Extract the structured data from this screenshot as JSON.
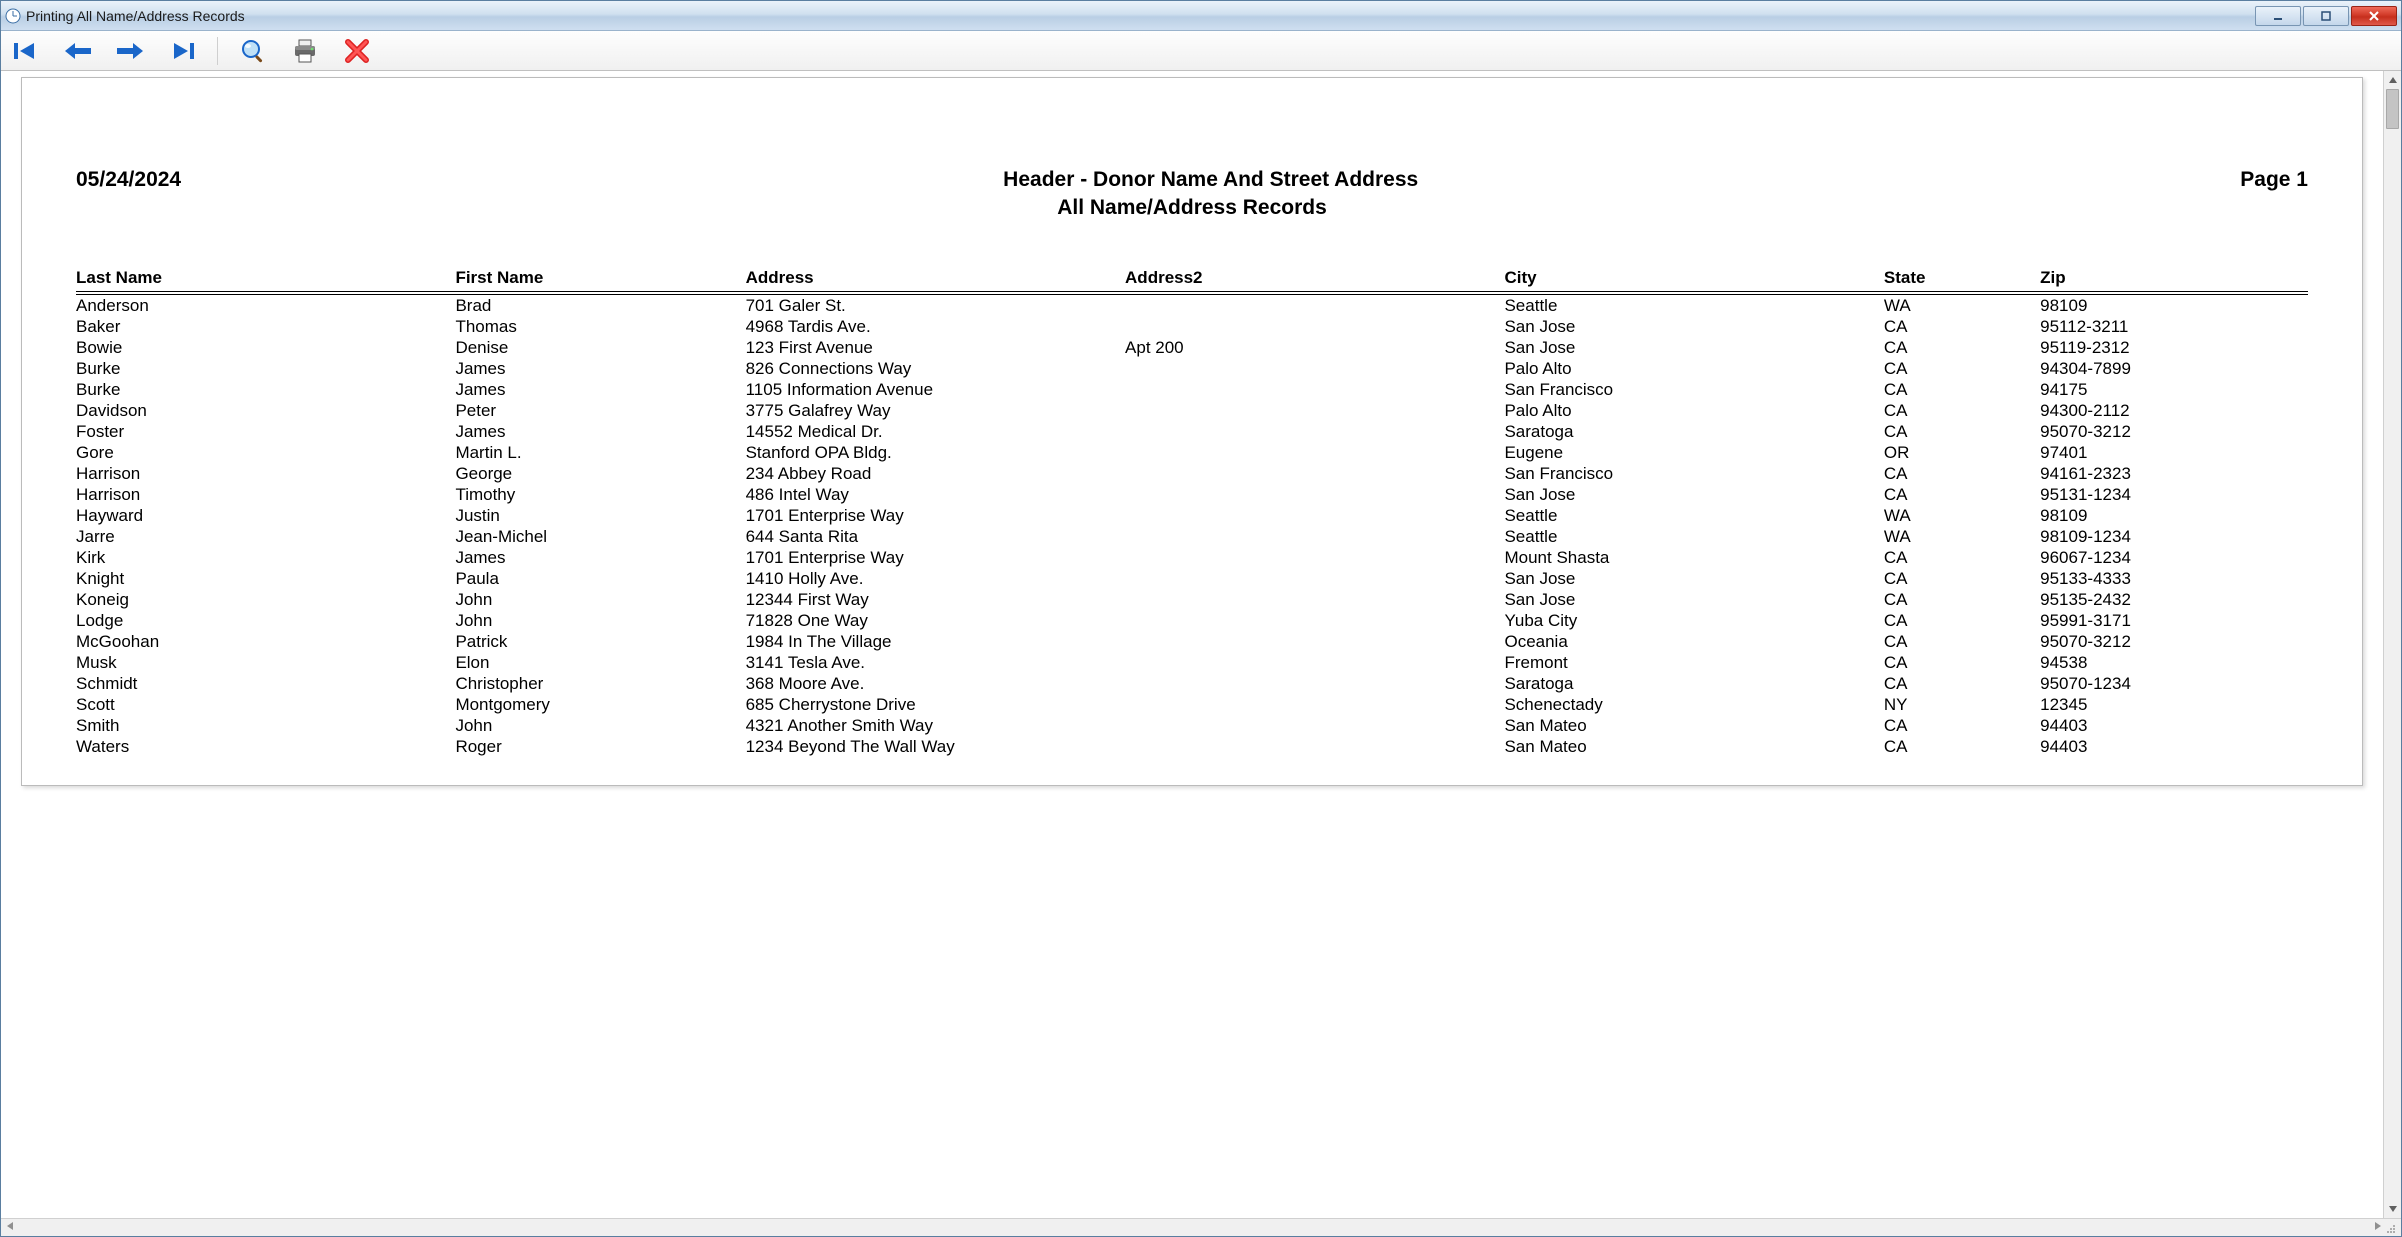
{
  "window": {
    "title": "Printing All Name/Address Records"
  },
  "report": {
    "date": "05/24/2024",
    "title": "Header - Donor Name And Street Address",
    "subtitle": "All Name/Address Records",
    "page_label": "Page 1"
  },
  "columns": {
    "last": "Last Name",
    "first": "First Name",
    "addr": "Address",
    "addr2": "Address2",
    "city": "City",
    "state": "State",
    "zip": "Zip"
  },
  "rows": [
    {
      "last": "Anderson",
      "first": "Brad",
      "addr": "701 Galer St.",
      "addr2": "",
      "city": "Seattle",
      "state": "WA",
      "zip": "98109"
    },
    {
      "last": "Baker",
      "first": "Thomas",
      "addr": "4968 Tardis Ave.",
      "addr2": "",
      "city": "San Jose",
      "state": "CA",
      "zip": "95112-3211"
    },
    {
      "last": "Bowie",
      "first": "Denise",
      "addr": "123 First Avenue",
      "addr2": "Apt 200",
      "city": "San Jose",
      "state": "CA",
      "zip": "95119-2312"
    },
    {
      "last": "Burke",
      "first": "James",
      "addr": "826 Connections Way",
      "addr2": "",
      "city": "Palo Alto",
      "state": "CA",
      "zip": "94304-7899"
    },
    {
      "last": "Burke",
      "first": "James",
      "addr": "1105 Information Avenue",
      "addr2": "",
      "city": "San Francisco",
      "state": "CA",
      "zip": "94175"
    },
    {
      "last": "Davidson",
      "first": "Peter",
      "addr": "3775 Galafrey Way",
      "addr2": "",
      "city": "Palo Alto",
      "state": "CA",
      "zip": "94300-2112"
    },
    {
      "last": "Foster",
      "first": "James",
      "addr": "14552 Medical Dr.",
      "addr2": "",
      "city": "Saratoga",
      "state": "CA",
      "zip": "95070-3212"
    },
    {
      "last": "Gore",
      "first": "Martin L.",
      "addr": "Stanford OPA Bldg.",
      "addr2": "",
      "city": "Eugene",
      "state": "OR",
      "zip": "97401"
    },
    {
      "last": "Harrison",
      "first": "George",
      "addr": "234 Abbey Road",
      "addr2": "",
      "city": "San Francisco",
      "state": "CA",
      "zip": "94161-2323"
    },
    {
      "last": "Harrison",
      "first": "Timothy",
      "addr": "486 Intel Way",
      "addr2": "",
      "city": "San Jose",
      "state": "CA",
      "zip": "95131-1234"
    },
    {
      "last": "Hayward",
      "first": "Justin",
      "addr": "1701 Enterprise Way",
      "addr2": "",
      "city": "Seattle",
      "state": "WA",
      "zip": "98109"
    },
    {
      "last": "Jarre",
      "first": "Jean-Michel",
      "addr": "644 Santa Rita",
      "addr2": "",
      "city": "Seattle",
      "state": "WA",
      "zip": "98109-1234"
    },
    {
      "last": "Kirk",
      "first": "James",
      "addr": "1701 Enterprise Way",
      "addr2": "",
      "city": "Mount Shasta",
      "state": "CA",
      "zip": "96067-1234"
    },
    {
      "last": "Knight",
      "first": "Paula",
      "addr": "1410 Holly Ave.",
      "addr2": "",
      "city": "San Jose",
      "state": "CA",
      "zip": "95133-4333"
    },
    {
      "last": "Koneig",
      "first": "John",
      "addr": "12344 First Way",
      "addr2": "",
      "city": "San Jose",
      "state": "CA",
      "zip": "95135-2432"
    },
    {
      "last": "Lodge",
      "first": "John",
      "addr": "71828 One Way",
      "addr2": "",
      "city": "Yuba City",
      "state": "CA",
      "zip": "95991-3171"
    },
    {
      "last": "McGoohan",
      "first": "Patrick",
      "addr": "1984 In The Village",
      "addr2": "",
      "city": "Oceania",
      "state": "CA",
      "zip": "95070-3212"
    },
    {
      "last": "Musk",
      "first": "Elon",
      "addr": "3141 Tesla Ave.",
      "addr2": "",
      "city": "Fremont",
      "state": "CA",
      "zip": "94538"
    },
    {
      "last": "Schmidt",
      "first": "Christopher",
      "addr": "368 Moore Ave.",
      "addr2": "",
      "city": "Saratoga",
      "state": "CA",
      "zip": "95070-1234"
    },
    {
      "last": "Scott",
      "first": "Montgomery",
      "addr": "685 Cherrystone Drive",
      "addr2": "",
      "city": "Schenectady",
      "state": "NY",
      "zip": "12345"
    },
    {
      "last": "Smith",
      "first": "John",
      "addr": "4321 Another Smith Way",
      "addr2": "",
      "city": "San Mateo",
      "state": "CA",
      "zip": "94403"
    },
    {
      "last": "Waters",
      "first": "Roger",
      "addr": "1234 Beyond The Wall Way",
      "addr2": "",
      "city": "San Mateo",
      "state": "CA",
      "zip": "94403"
    }
  ]
}
